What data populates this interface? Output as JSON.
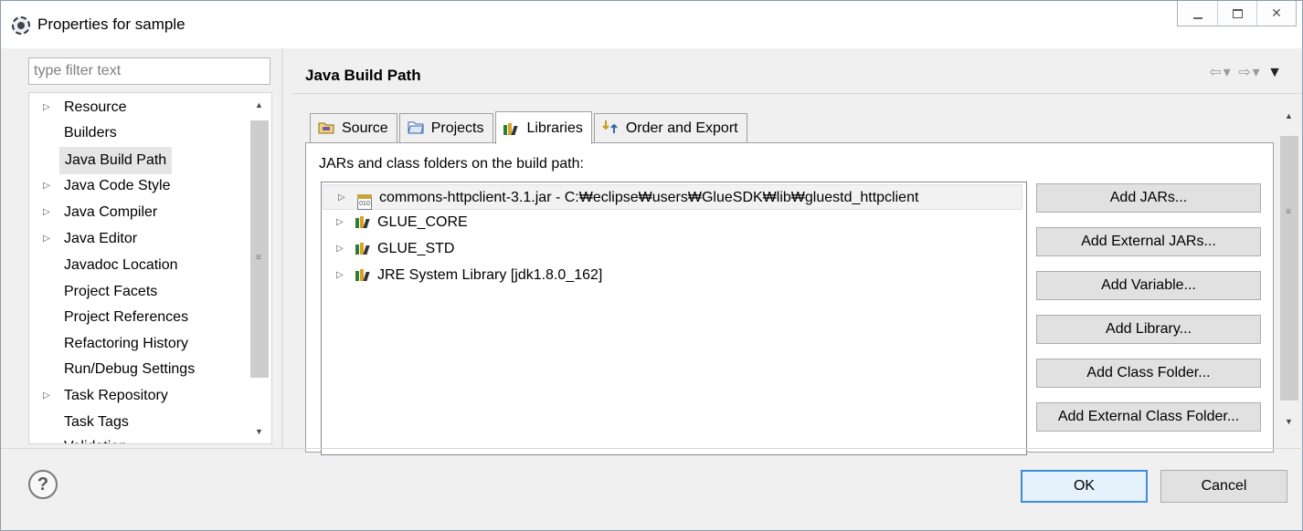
{
  "window": {
    "title": "Properties for sample",
    "controls": {
      "minimize": "minimize-icon",
      "maximize": "maximize-icon",
      "close": "✕"
    }
  },
  "filter": {
    "placeholder": "type filter text",
    "value": ""
  },
  "nav": {
    "items": [
      {
        "label": "Resource",
        "expandable": true
      },
      {
        "label": "Builders",
        "expandable": false
      },
      {
        "label": "Java Build Path",
        "expandable": false,
        "selected": true
      },
      {
        "label": "Java Code Style",
        "expandable": true
      },
      {
        "label": "Java Compiler",
        "expandable": true
      },
      {
        "label": "Java Editor",
        "expandable": true
      },
      {
        "label": "Javadoc Location",
        "expandable": false
      },
      {
        "label": "Project Facets",
        "expandable": false
      },
      {
        "label": "Project References",
        "expandable": false
      },
      {
        "label": "Refactoring History",
        "expandable": false
      },
      {
        "label": "Run/Debug Settings",
        "expandable": false
      },
      {
        "label": "Task Repository",
        "expandable": true
      },
      {
        "label": "Task Tags",
        "expandable": false
      },
      {
        "label": "Validation",
        "expandable": true
      }
    ]
  },
  "page": {
    "title": "Java Build Path",
    "history": {
      "back": "⇦",
      "forward": "⇨",
      "menu": "▼"
    }
  },
  "tabs": [
    {
      "label": "Source",
      "icon": "source-folder-icon",
      "active": false
    },
    {
      "label": "Projects",
      "icon": "projects-folder-icon",
      "active": false
    },
    {
      "label": "Libraries",
      "icon": "library-books-icon",
      "active": true
    },
    {
      "label": "Order and Export",
      "icon": "order-export-icon",
      "active": false
    }
  ],
  "libraries": {
    "description": "JARs and class folders on the build path:",
    "entries": [
      {
        "label": "commons-httpclient-3.1.jar - C:₩eclipse₩users₩GlueSDK₩lib₩gluestd_httpclient",
        "icon": "jar-icon",
        "jar_text": "010"
      },
      {
        "label": "GLUE_CORE",
        "icon": "library-icon"
      },
      {
        "label": "GLUE_STD",
        "icon": "library-icon"
      },
      {
        "label": "JRE System Library [jdk1.8.0_162]",
        "icon": "library-icon"
      }
    ],
    "buttons": [
      "Add JARs...",
      "Add External JARs...",
      "Add Variable...",
      "Add Library...",
      "Add Class Folder...",
      "Add External Class Folder..."
    ]
  },
  "footer": {
    "help": "?",
    "ok": "OK",
    "cancel": "Cancel"
  },
  "colors": {
    "accent": "#3c8fd8",
    "selection": "#e5e5e5",
    "library_icon": [
      "#2f7d32",
      "#d8a323",
      "#333333"
    ]
  }
}
